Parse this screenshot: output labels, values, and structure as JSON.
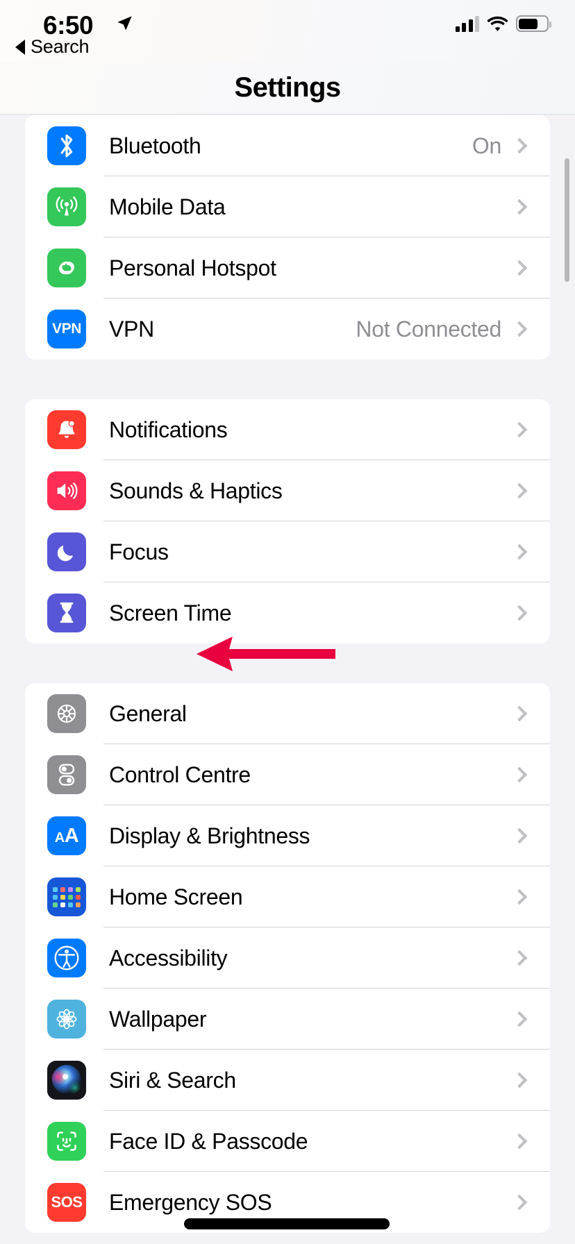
{
  "status_bar": {
    "time": "6:50",
    "location_icon": "location-arrow-icon",
    "signal_icon": "cellular-signal-icon",
    "wifi_icon": "wifi-icon",
    "battery_icon": "battery-icon"
  },
  "nav": {
    "back_label": "Search",
    "back_icon": "back-caret-icon",
    "title": "Settings"
  },
  "annotation": {
    "type": "arrow",
    "points_to": "General",
    "color": "#E8003F",
    "direction": "left"
  },
  "groups": [
    {
      "id": "connectivity",
      "rows": [
        {
          "label": "Bluetooth",
          "value": "On",
          "icon": "bluetooth-icon",
          "icon_color": "#007AFF"
        },
        {
          "label": "Mobile Data",
          "value": "",
          "icon": "mobile-data-icon",
          "icon_color": "#34C759"
        },
        {
          "label": "Personal Hotspot",
          "value": "",
          "icon": "personal-hotspot-icon",
          "icon_color": "#34C759"
        },
        {
          "label": "VPN",
          "value": "Not Connected",
          "icon": "vpn-icon",
          "icon_color": "#007AFF"
        }
      ]
    },
    {
      "id": "alerts",
      "rows": [
        {
          "label": "Notifications",
          "value": "",
          "icon": "notifications-bell-icon",
          "icon_color": "#FF3B30"
        },
        {
          "label": "Sounds & Haptics",
          "value": "",
          "icon": "sounds-speaker-icon",
          "icon_color": "#FF2D55"
        },
        {
          "label": "Focus",
          "value": "",
          "icon": "focus-moon-icon",
          "icon_color": "#5856D6"
        },
        {
          "label": "Screen Time",
          "value": "",
          "icon": "screen-time-hourglass-icon",
          "icon_color": "#5856D6"
        }
      ]
    },
    {
      "id": "system",
      "rows": [
        {
          "label": "General",
          "value": "",
          "icon": "general-gear-icon",
          "icon_color": "#8E8E93"
        },
        {
          "label": "Control Centre",
          "value": "",
          "icon": "control-centre-icon",
          "icon_color": "#8E8E93"
        },
        {
          "label": "Display & Brightness",
          "value": "",
          "icon": "display-brightness-icon",
          "icon_color": "#007AFF"
        },
        {
          "label": "Home Screen",
          "value": "",
          "icon": "home-screen-grid-icon",
          "icon_color": "#1557D6"
        },
        {
          "label": "Accessibility",
          "value": "",
          "icon": "accessibility-icon",
          "icon_color": "#007AFF"
        },
        {
          "label": "Wallpaper",
          "value": "",
          "icon": "wallpaper-flower-icon",
          "icon_color": "#4FB3DE"
        },
        {
          "label": "Siri & Search",
          "value": "",
          "icon": "siri-orb-icon",
          "icon_color": "#1A1A22"
        },
        {
          "label": "Face ID & Passcode",
          "value": "",
          "icon": "face-id-icon",
          "icon_color": "#30D158"
        },
        {
          "label": "Emergency SOS",
          "value": "",
          "icon": "emergency-sos-icon",
          "icon_color": "#FF3B30"
        }
      ]
    }
  ]
}
